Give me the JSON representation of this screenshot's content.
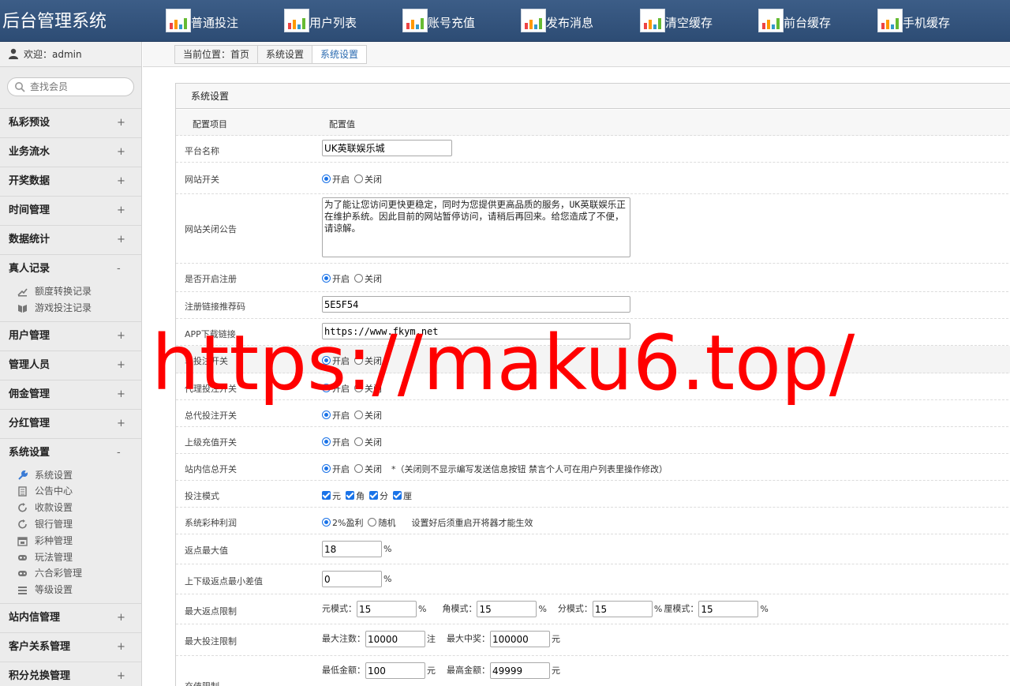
{
  "brand": "后台管理系统",
  "nav": [
    {
      "label": "普通投注",
      "icon": "chart-icon"
    },
    {
      "label": "用户列表",
      "icon": "chart-icon"
    },
    {
      "label": "账号充值",
      "icon": "chart-icon"
    },
    {
      "label": "发布消息",
      "icon": "chart-icon"
    },
    {
      "label": "清空缓存",
      "icon": "chart-icon"
    },
    {
      "label": "前台缓存",
      "icon": "chart-icon"
    },
    {
      "label": "手机缓存",
      "icon": "chart-icon"
    }
  ],
  "sidebar": {
    "welcome": "欢迎：admin",
    "search_placeholder": "查找会员",
    "groups": [
      {
        "label": "私彩预设",
        "toggle": "+"
      },
      {
        "label": "业务流水",
        "toggle": "+"
      },
      {
        "label": "开奖数据",
        "toggle": "+"
      },
      {
        "label": "时间管理",
        "toggle": "+"
      },
      {
        "label": "数据统计",
        "toggle": "+"
      },
      {
        "label": "真人记录",
        "toggle": "-",
        "items": [
          {
            "label": "额度转换记录",
            "icon": "transfer-icon"
          },
          {
            "label": "游戏投注记录",
            "icon": "book-icon"
          }
        ]
      },
      {
        "label": "用户管理",
        "toggle": "+"
      },
      {
        "label": "管理人员",
        "toggle": "+"
      },
      {
        "label": "佣金管理",
        "toggle": "+"
      },
      {
        "label": "分红管理",
        "toggle": "+"
      },
      {
        "label": "系统设置",
        "toggle": "-",
        "items": [
          {
            "label": "系统设置",
            "icon": "wrench-icon"
          },
          {
            "label": "公告中心",
            "icon": "document-icon"
          },
          {
            "label": "收款设置",
            "icon": "refresh-icon"
          },
          {
            "label": "银行管理",
            "icon": "refresh-icon"
          },
          {
            "label": "彩种管理",
            "icon": "calendar-icon"
          },
          {
            "label": "玩法管理",
            "icon": "gamepad-icon"
          },
          {
            "label": "六合彩管理",
            "icon": "gamepad-icon"
          },
          {
            "label": "等级设置",
            "icon": "list-icon"
          }
        ]
      },
      {
        "label": "站内信管理",
        "toggle": "+"
      },
      {
        "label": "客户关系管理",
        "toggle": "+"
      },
      {
        "label": "积分兑换管理",
        "toggle": "+"
      }
    ]
  },
  "breadcrumb": {
    "current": "当前位置：首页",
    "items": [
      "系统设置",
      "系统设置"
    ]
  },
  "panel": {
    "title": "系统设置",
    "col_key": "配置项目",
    "col_val": "配置值",
    "platform_name": {
      "label": "平台名称",
      "value": "UK英联娱乐城"
    },
    "site_switch": {
      "label": "网站开关",
      "on": "开启",
      "off": "关闭"
    },
    "close_notice": {
      "label": "网站关闭公告",
      "value": "为了能让您访问更快更稳定，同时为您提供更高品质的服务，UK英联娱乐正在维护系统。因此目前的网站暂停访问，请稍后再回来。给您造成了不便，请谅解。"
    },
    "register_switch": {
      "label": "是否开启注册",
      "on": "开启",
      "off": "关闭"
    },
    "register_code": {
      "label": "注册链接推荐码",
      "value": "5E5F54"
    },
    "app_link": {
      "label": "APP下载链接",
      "value": "https://www.fkym.net"
    },
    "bet_switch": {
      "label": "单投注开关",
      "on": "开启",
      "off": "关闭"
    },
    "agent_bet_switch": {
      "label": "代理投注开关",
      "on": "开启",
      "off": "关闭"
    },
    "general_agent_bet": {
      "label": "总代投注开关",
      "on": "开启",
      "off": "关闭"
    },
    "parent_recharge": {
      "label": "上级充值开关",
      "on": "开启",
      "off": "关闭"
    },
    "message_switch": {
      "label": "站内信总开关",
      "on": "开启",
      "off": "关闭",
      "note": "*（关闭则不显示编写发送信息按钮 禁言个人可在用户列表里操作修改）"
    },
    "bet_mode": {
      "label": "投注模式",
      "options": [
        "元",
        "角",
        "分",
        "厘"
      ]
    },
    "lottery_profit": {
      "label": "系统彩种利润",
      "opt1": "2%盈利",
      "opt2": "随机",
      "note": "设置好后须重启开将器才能生效"
    },
    "max_rebate": {
      "label": "返点最大值",
      "value": "18",
      "unit": "%"
    },
    "min_rebate_diff": {
      "label": "上下级返点最小差值",
      "value": "0",
      "unit": "%"
    },
    "max_rebate_limit": {
      "label": "最大返点限制",
      "yuan_label": "元模式：",
      "yuan": "15",
      "jiao_label": "角模式：",
      "jiao": "15",
      "fen_label": "分模式：",
      "fen": "15",
      "li_label": "厘模式：",
      "li": "15",
      "unit": "%"
    },
    "max_bet_limit": {
      "label": "最大投注限制",
      "count_label": "最大注数：",
      "count": "10000",
      "count_unit": "注",
      "prize_label": "最大中奖：",
      "prize": "100000",
      "prize_unit": "元"
    },
    "recharge_limit": {
      "label": "充值限制",
      "min_label": "最低金额：",
      "min": "100",
      "min_unit": "元",
      "max_label": "最高金额：",
      "max": "49999",
      "max_unit": "元"
    }
  },
  "watermark": "https://maku6.top/"
}
